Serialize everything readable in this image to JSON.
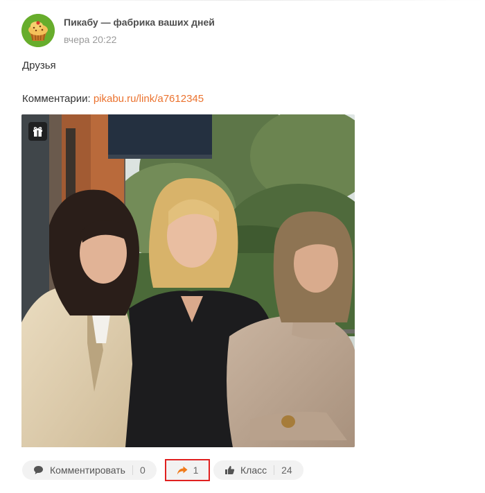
{
  "post": {
    "author": "Пикабу — фабрика ваших дней",
    "time": "вчера 20:22",
    "text": "Друзья",
    "comments_prefix": "Комментарии: ",
    "comments_link": "pikabu.ru/link/a7612345"
  },
  "photo": {
    "icon": "gift-icon"
  },
  "actions": {
    "comment_label": "Комментировать",
    "comment_count": "0",
    "share_count": "1",
    "like_label": "Класс",
    "like_count": "24"
  },
  "colors": {
    "link": "#eb722e",
    "share_arrow": "#f07a1a",
    "highlight": "#e0201f",
    "avatar_bg": "#6fb32f"
  }
}
